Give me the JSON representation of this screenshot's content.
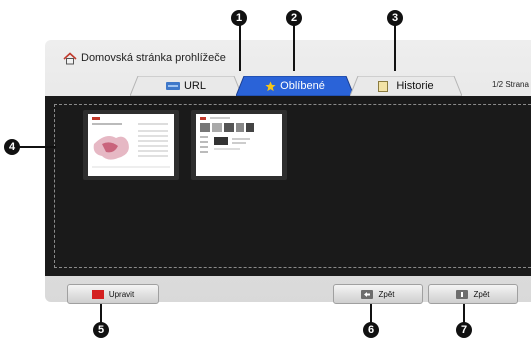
{
  "browser": {
    "home_title": "Domovská stránka prohlížeče",
    "page_indicator": "1/2 Strana"
  },
  "tabs": [
    {
      "label": "URL",
      "icon": "url-icon",
      "active": false
    },
    {
      "label": "Oblíbené",
      "icon": "star-icon",
      "active": true
    },
    {
      "label": "Historie",
      "icon": "history-icon",
      "active": false
    }
  ],
  "buttons": {
    "edit": {
      "label": "Upravit",
      "key_color": "#d42020"
    },
    "back1": {
      "label": "Zpět",
      "icon": "back-key-icon"
    },
    "back2": {
      "label": "Zpět",
      "icon": "info-key-icon"
    }
  },
  "callouts": [
    "1",
    "2",
    "3",
    "4",
    "5",
    "6",
    "7"
  ],
  "colors": {
    "accent_tab": "#2a63d8",
    "content_bg": "#1a1a1a",
    "frame_bg": "#e4e4e4"
  }
}
